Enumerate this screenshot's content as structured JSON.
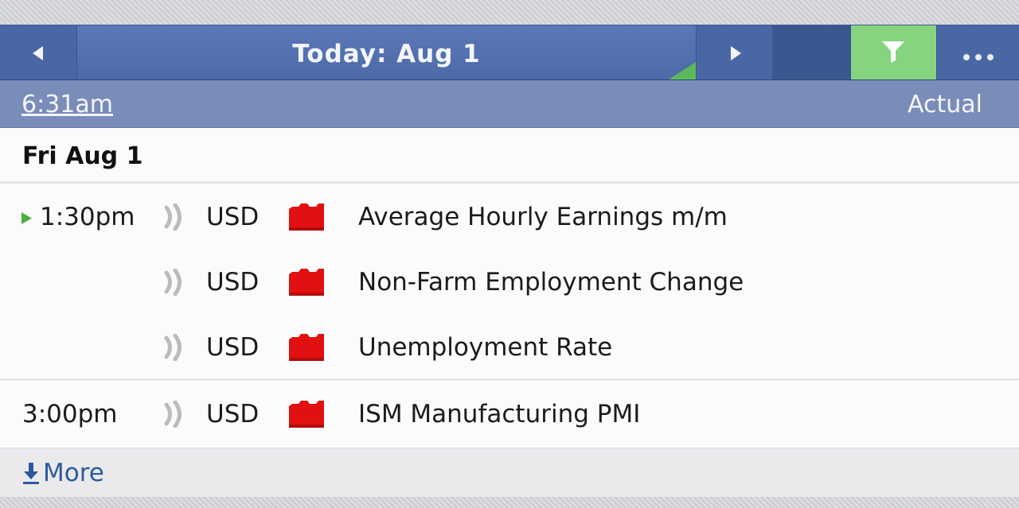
{
  "navbar": {
    "title": "Today: Aug 1",
    "prev_icon": "triangle-left-icon",
    "next_icon": "triangle-right-icon",
    "filter_icon": "funnel-icon",
    "more_icon": "ellipsis-icon",
    "filter_active_color": "#86d47f"
  },
  "timebar": {
    "current_time": "6:31am",
    "column_label": "Actual"
  },
  "day": {
    "label": "Fri Aug 1"
  },
  "events": [
    {
      "time": "1:30pm",
      "currency": "USD",
      "title": "Average Hourly Earnings m/m",
      "impact": "high",
      "is_next": true
    },
    {
      "time": "",
      "currency": "USD",
      "title": "Non-Farm Employment Change",
      "impact": "high",
      "is_next": false
    },
    {
      "time": "",
      "currency": "USD",
      "title": "Unemployment Rate",
      "impact": "high",
      "is_next": false
    },
    {
      "time": "3:00pm",
      "currency": "USD",
      "title": "ISM Manufacturing PMI",
      "impact": "high",
      "is_next": false
    }
  ],
  "colors": {
    "impact_high": "#e21010",
    "next_marker": "#4fae3f",
    "nav_blue": "#4d6aa8",
    "link_blue": "#2d5a9a"
  },
  "footer": {
    "more_label": "More",
    "more_icon": "download-arrow-icon"
  }
}
